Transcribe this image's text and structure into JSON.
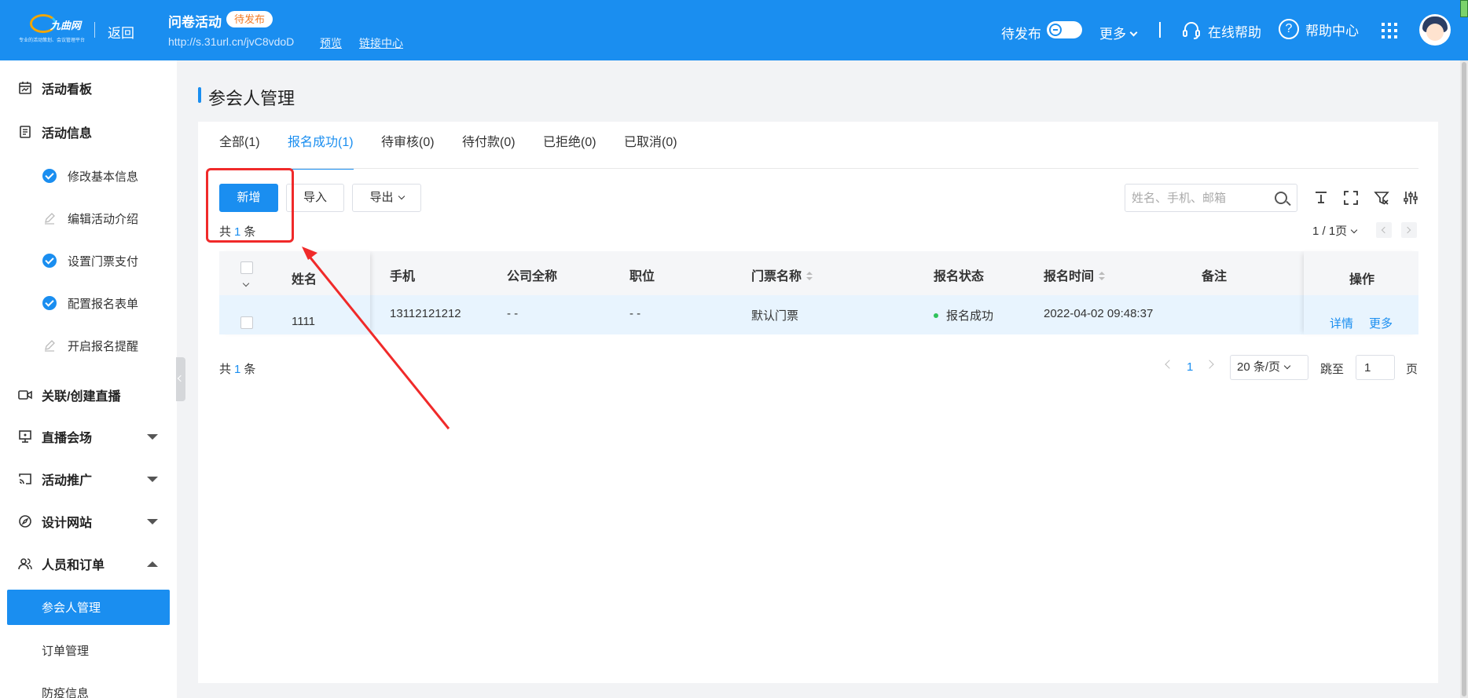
{
  "header": {
    "logo_brand": "九曲网",
    "logo_slogan": "专业的活动策划、会议管理平台",
    "back_label": "返回",
    "activity_title": "问卷活动",
    "status_badge": "待发布",
    "activity_url": "http://s.31url.cn/jvC8vdoD",
    "preview_label": "预览",
    "link_center_label": "链接中心",
    "publish_label": "待发布",
    "more_label": "更多",
    "online_help_label": "在线帮助",
    "help_center_label": "帮助中心"
  },
  "sidebar": {
    "items": [
      {
        "label": "活动看板",
        "icon": "dashboard-icon"
      },
      {
        "label": "活动信息",
        "icon": "document-icon"
      },
      {
        "label": "修改基本信息",
        "icon": "check-circle-icon"
      },
      {
        "label": "编辑活动介绍",
        "icon": "pencil-icon"
      },
      {
        "label": "设置门票支付",
        "icon": "check-circle-icon"
      },
      {
        "label": "配置报名表单",
        "icon": "check-circle-icon"
      },
      {
        "label": "开启报名提醒",
        "icon": "pencil-icon"
      },
      {
        "label": "关联/创建直播",
        "icon": "video-icon"
      },
      {
        "label": "直播会场",
        "icon": "presentation-icon"
      },
      {
        "label": "活动推广",
        "icon": "cast-icon"
      },
      {
        "label": "设计网站",
        "icon": "compass-icon"
      },
      {
        "label": "人员和订单",
        "icon": "users-icon"
      },
      {
        "label": "参会人管理"
      },
      {
        "label": "订单管理"
      },
      {
        "label": "防疫信息"
      }
    ]
  },
  "main": {
    "page_title": "参会人管理",
    "tabs": [
      {
        "label": "全部(1)"
      },
      {
        "label": "报名成功(1)"
      },
      {
        "label": "待审核(0)"
      },
      {
        "label": "待付款(0)"
      },
      {
        "label": "已拒绝(0)"
      },
      {
        "label": "已取消(0)"
      }
    ],
    "toolbar": {
      "add_label": "新增",
      "import_label": "导入",
      "export_label": "导出",
      "search_placeholder": "姓名、手机、邮箱"
    },
    "count": {
      "prefix": "共",
      "num": "1",
      "suffix": "条"
    },
    "pager_top": "1 / 1页",
    "table": {
      "columns": [
        "姓名",
        "手机",
        "公司全称",
        "职位",
        "门票名称",
        "报名状态",
        "报名时间",
        "备注",
        "操作"
      ],
      "rows": [
        {
          "name": "1111",
          "phone": "13112121212",
          "company": "- -",
          "position": "- -",
          "ticket": "默认门票",
          "status": "报名成功",
          "time": "2022-04-02 09:48:37",
          "remark": "",
          "actions": [
            "详情",
            "更多"
          ]
        }
      ]
    },
    "pagination": {
      "current_page": "1",
      "page_size": "20 条/页",
      "jump_label": "跳至",
      "jump_value": "1",
      "page_suffix": "页"
    }
  },
  "colors": {
    "primary": "#1a8ef0",
    "success": "#2fc25b",
    "annotation": "#f02a2a",
    "badge_text": "#f27b24"
  }
}
